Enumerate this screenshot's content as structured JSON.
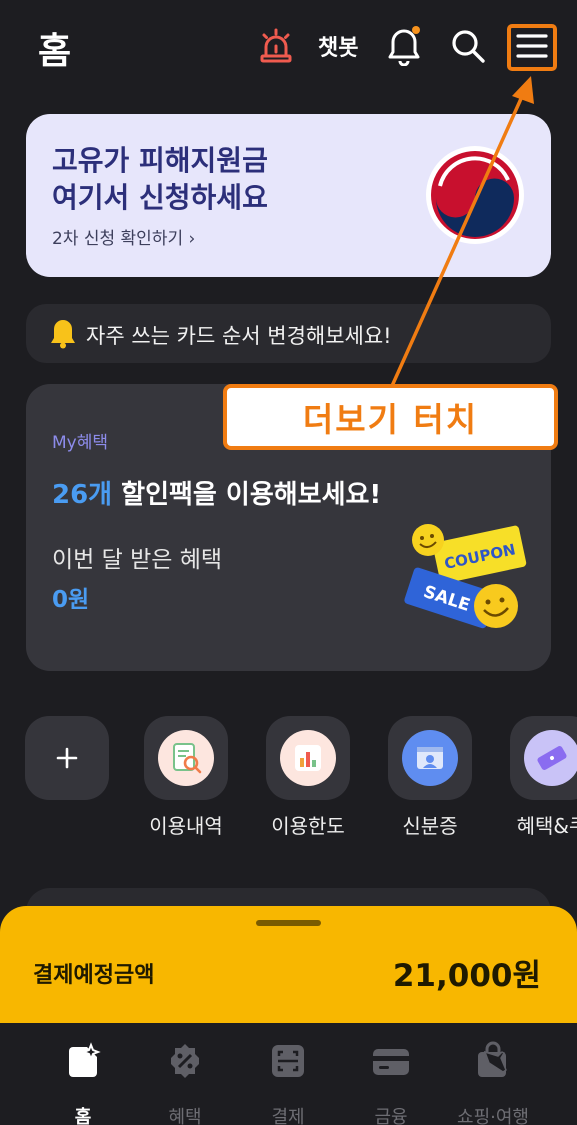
{
  "header": {
    "title": "홈",
    "chatbot_label": "챗봇",
    "icons": [
      "siren-icon",
      "bell-icon",
      "search-icon",
      "menu-icon"
    ],
    "alert_color": "#f05b4f",
    "notification_dot_color": "#f7931e"
  },
  "banner": {
    "title": "고유가 피해지원금\n여기서 신청하세요",
    "link_label": "2차 신청 확인하기 ›",
    "emblem_icon": "korea-government-emblem"
  },
  "notice": {
    "icon": "bell-icon",
    "text": "자주 쓰는 카드 순서 변경해보세요!"
  },
  "my_benefit": {
    "label": "My혜택",
    "count": "26개",
    "headline_rest": " 할인팩을 이용해보세요!",
    "sub_label": "이번 달 받은 혜택",
    "amount": "0원",
    "coupon_text": "COUPON",
    "sale_text": "SALE"
  },
  "shortcuts": {
    "add_icon": "plus-icon",
    "items": [
      {
        "label": "이용내역",
        "icon": "receipt-search-icon"
      },
      {
        "label": "이용한도",
        "icon": "bar-chart-icon"
      },
      {
        "label": "신분증",
        "icon": "id-card-icon"
      },
      {
        "label": "혜택&쿠",
        "icon": "coupon-ticket-icon"
      }
    ]
  },
  "callout": {
    "text": "더보기 터치",
    "color": "#f07c12"
  },
  "payment": {
    "label": "결제예정금액",
    "amount": "21,000원",
    "background": "#f8b700"
  },
  "tabbar": {
    "tabs": [
      {
        "label": "홈",
        "icon": "home-icon",
        "active": true
      },
      {
        "label": "혜택",
        "icon": "discount-badge-icon",
        "active": false
      },
      {
        "label": "결제",
        "icon": "scan-pay-icon",
        "active": false
      },
      {
        "label": "금융",
        "icon": "wallet-icon",
        "active": false
      },
      {
        "label": "쇼핑·여행",
        "icon": "shopping-travel-icon",
        "active": false
      }
    ]
  }
}
